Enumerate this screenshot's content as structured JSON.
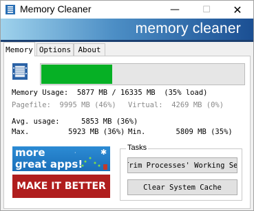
{
  "window": {
    "title": "Memory Cleaner",
    "minimize_glyph": "—",
    "maximize_glyph": "☐",
    "close_glyph": "✕"
  },
  "banner": {
    "text": "memory cleaner"
  },
  "tabs": [
    {
      "label": "Memory",
      "active": true
    },
    {
      "label": "Options",
      "active": false
    },
    {
      "label": "About",
      "active": false
    }
  ],
  "memory": {
    "load_fraction": 0.35,
    "usage_line": "Memory Usage:  5877 MB / 16335 MB  (35% load)",
    "pagefile_line": "Pagefile:  9995 MB (46%)",
    "virtual_line": "Virtual:  4269 MB (0%)",
    "avg_line": "Avg. usage:     5853 MB (36%)",
    "max_line": "Max.         5923 MB (36%)",
    "min_line": "Min.       5809 MB (35%)"
  },
  "promos": {
    "more_apps_line1": "more",
    "more_apps_line2": "great apps!",
    "make_it_better": "MAKE IT BETTER"
  },
  "tasks": {
    "legend": "Tasks",
    "trim_button": "Trim Processes' Working Set",
    "clear_cache_button": "Clear System Cache"
  },
  "colors": {
    "progress_fill": "#06b025",
    "banner_dark": "#1b4f93",
    "promo_red": "#b01e1e",
    "promo_blue": "#1a6fb9"
  }
}
